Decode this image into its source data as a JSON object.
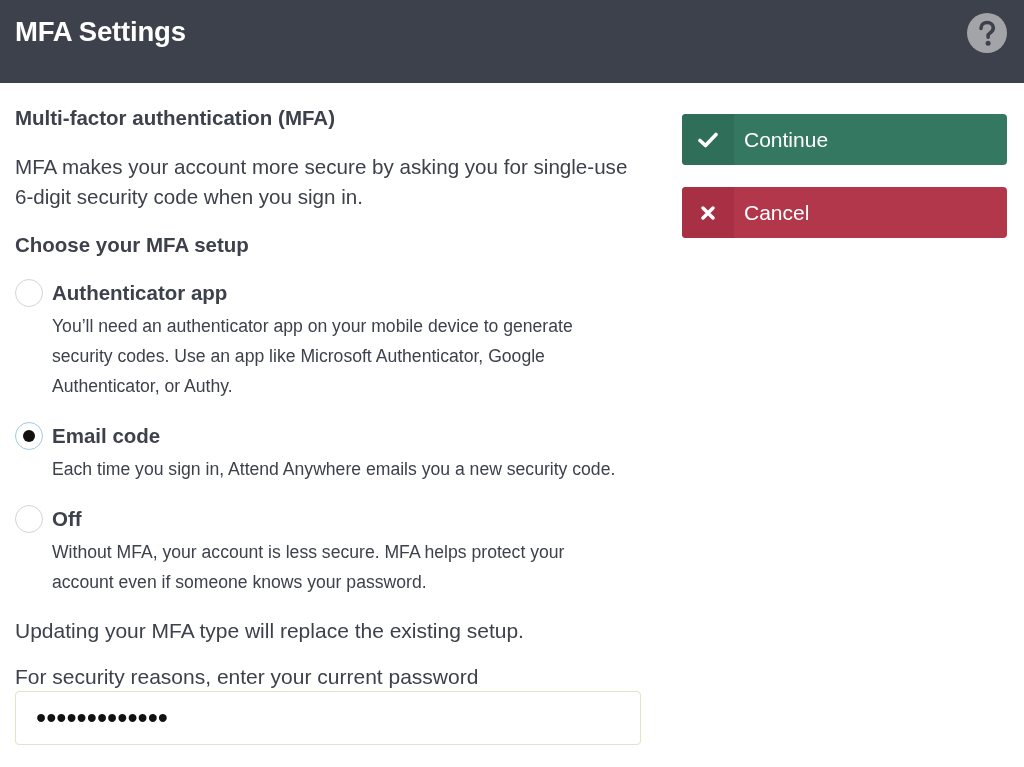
{
  "header": {
    "title": "MFA Settings"
  },
  "heading": "Multi-factor authentication (MFA)",
  "intro": "MFA makes your account more secure by asking you for single-use 6-digit security code when you sign in.",
  "options_heading": "Choose your MFA setup",
  "options": [
    {
      "label": "Authenticator app",
      "description": "You’ll need an authenticator app on your mobile device to generate security codes. Use an app like Microsoft Authenticator, Google Authenticator, or Authy.",
      "selected": false
    },
    {
      "label": "Email code",
      "description": "Each time you sign in, Attend Anywhere emails you a new security code.",
      "selected": true
    },
    {
      "label": "Off",
      "description": "Without MFA, your account is less secure. MFA helps protect your account even if someone knows your password.",
      "selected": false
    }
  ],
  "notice": "Updating your MFA type will replace the existing setup.",
  "password": {
    "label": "For security reasons, enter your current password",
    "value": "•••••••••••••"
  },
  "buttons": [
    {
      "kind": "confirm",
      "label": "Continue"
    },
    {
      "kind": "cancel",
      "label": "Cancel"
    }
  ]
}
